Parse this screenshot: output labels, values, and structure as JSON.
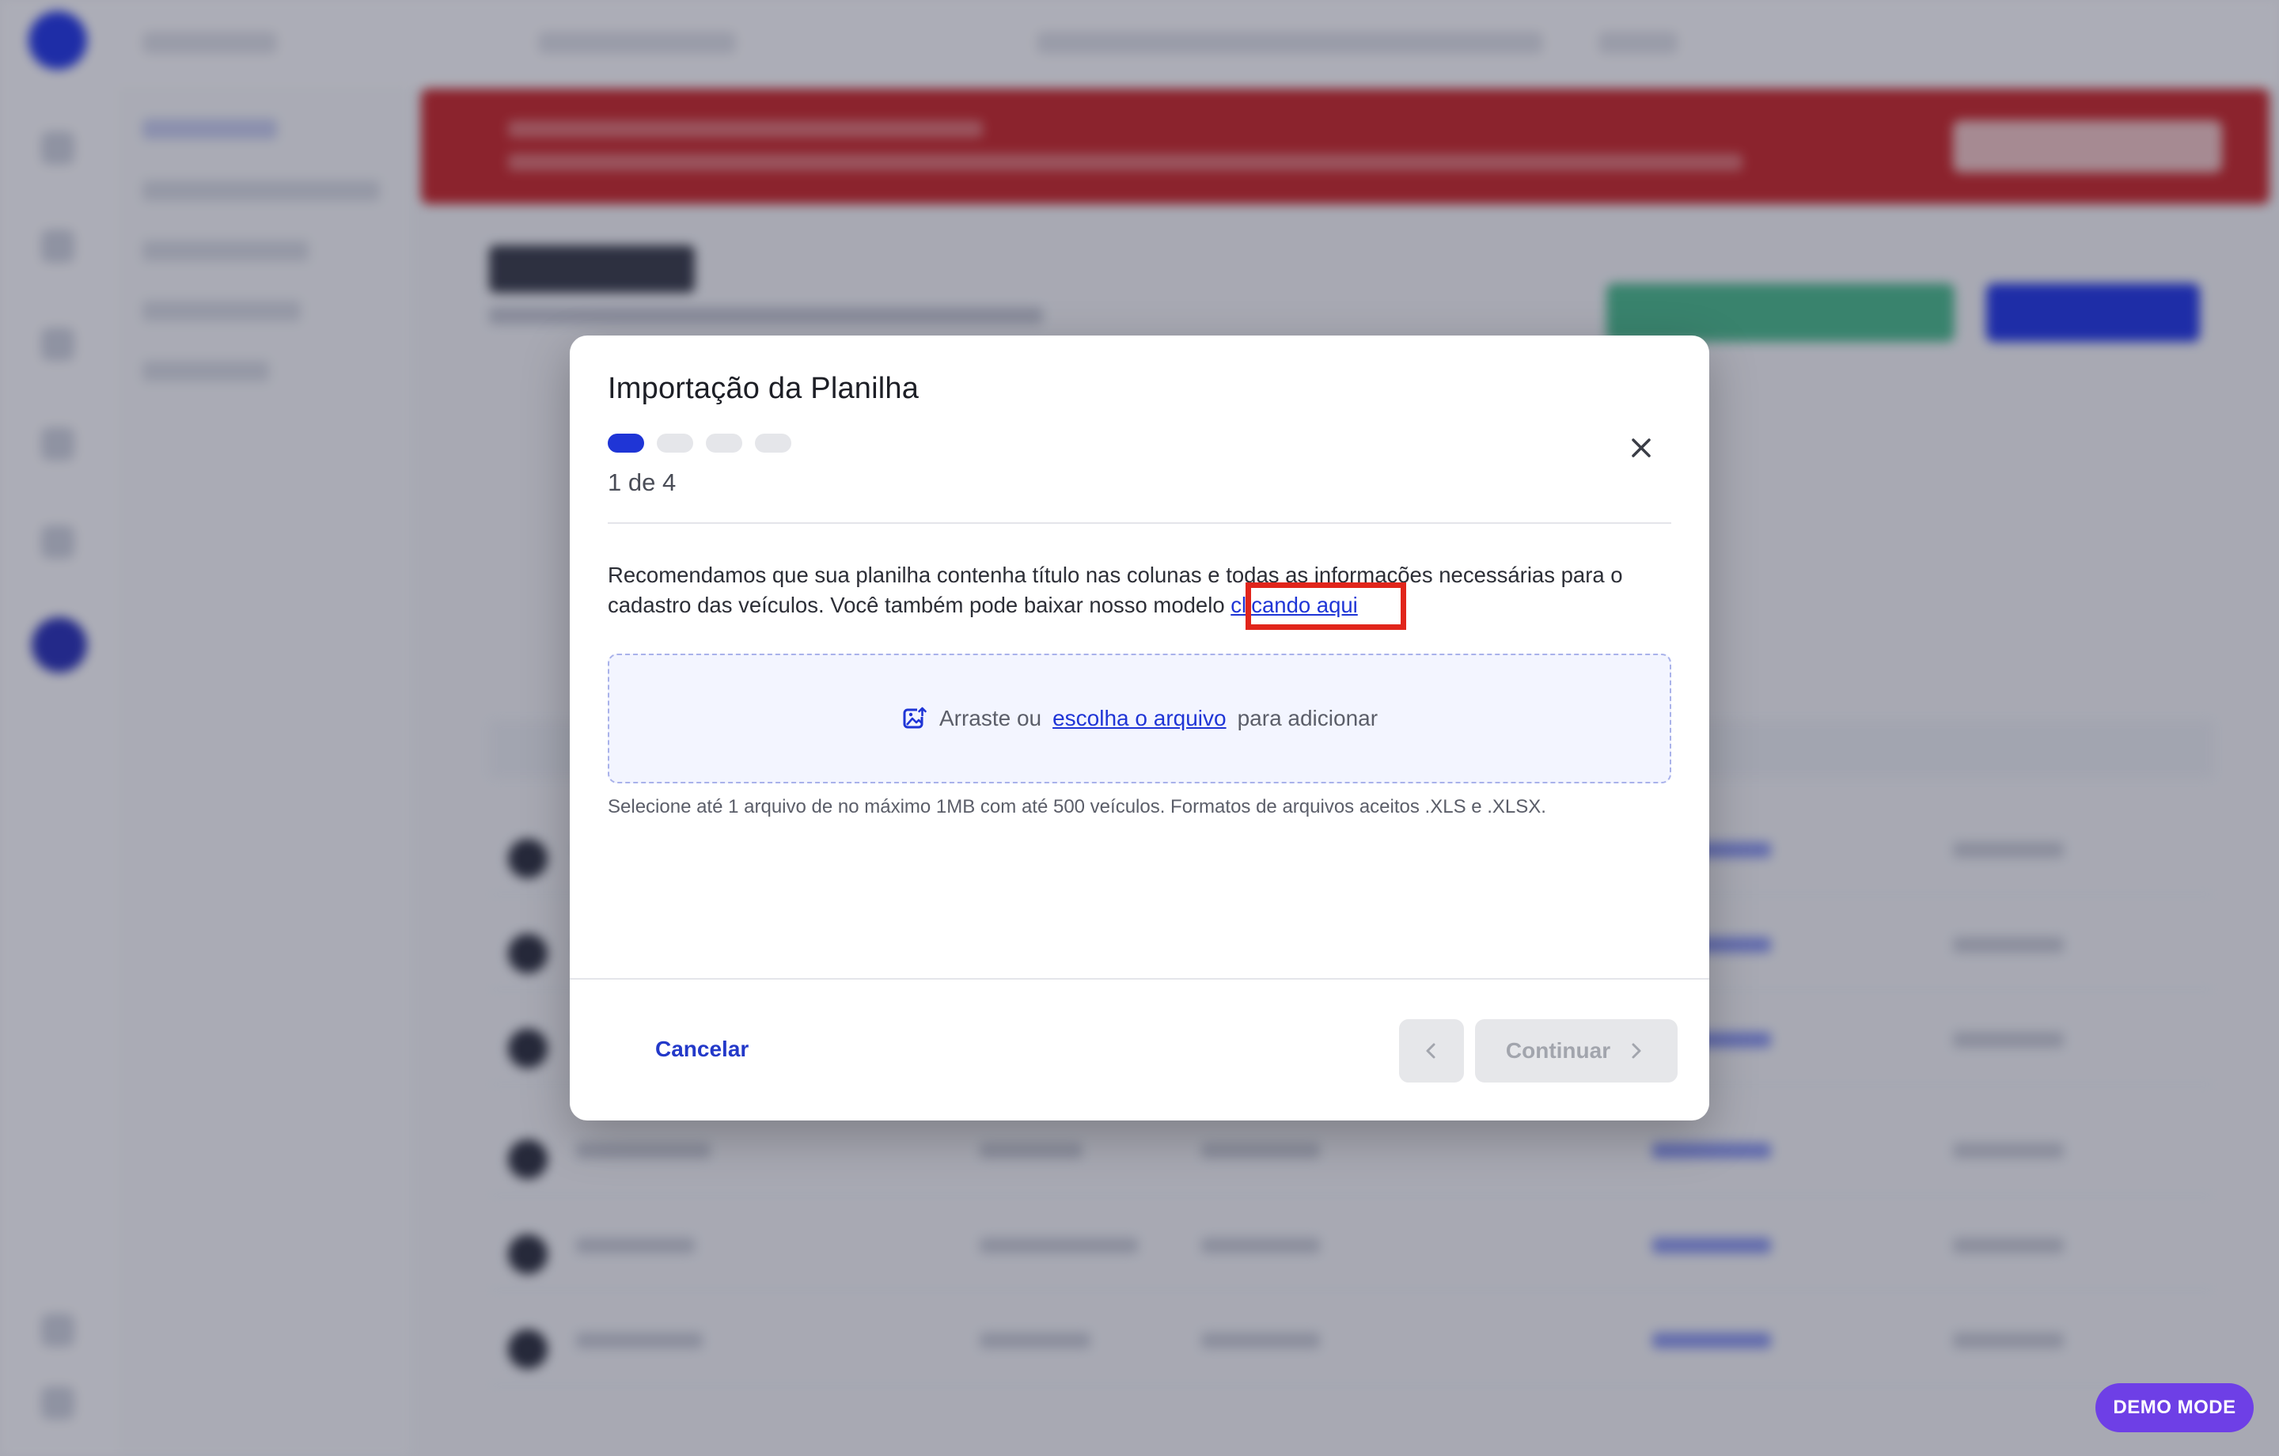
{
  "modal": {
    "title": "Importação da Planilha",
    "steps": {
      "total": 4,
      "current": 1
    },
    "step_counter": "1 de 4",
    "description": "Recomendamos que sua planilha contenha título nas colunas e todas as informações necessárias para o cadastro das veículos. Você também pode baixar nosso modelo ",
    "template_link": "clicando aqui",
    "dropzone": {
      "prefix": "Arraste ou",
      "link": "escolha o arquivo",
      "suffix": "para adicionar",
      "icon": "image-upload-icon"
    },
    "hint": "Selecione até 1 arquivo de no máximo 1MB com até 500 veículos. Formatos de arquivos aceitos .XLS e .XLSX.",
    "cancel_label": "Cancelar",
    "continue_label": "Continuar"
  },
  "demo_badge": "DEMO MODE",
  "colors": {
    "accent": "#1f35d6",
    "alert": "#c9292c",
    "highlight": "#e1251b",
    "demo": "#6e3fe6"
  }
}
